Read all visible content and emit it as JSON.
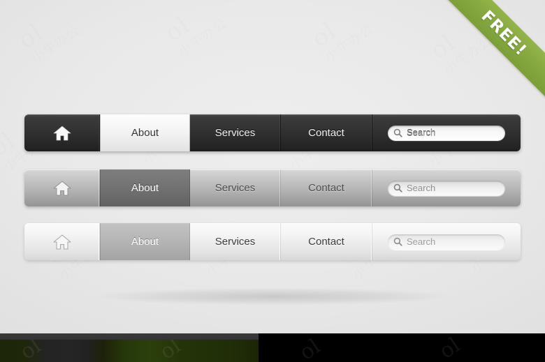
{
  "ribbon": {
    "label": "FREE!",
    "color": "#86a940",
    "text_color": "#ffffff"
  },
  "background": {
    "color": "#e9e9e9",
    "watermark_text": "ol",
    "watermark_subtext": "小牛办公"
  },
  "navbars": [
    {
      "id": "dark",
      "style_name": "dark-navbar",
      "background_color": "#2b2b2b",
      "text_color": "#f2f2f2",
      "active_item": "About",
      "active_background": "#f3f3f3",
      "active_text_color": "#333333",
      "items": [
        {
          "name": "home",
          "label": "",
          "icon": "home-icon"
        },
        {
          "name": "about",
          "label": "About",
          "icon": ""
        },
        {
          "name": "services",
          "label": "Services",
          "icon": ""
        },
        {
          "name": "contact",
          "label": "Contact",
          "icon": ""
        }
      ],
      "search": {
        "placeholder": "Search",
        "value": "",
        "icon": "search-icon",
        "field_background": "#ffffff"
      }
    },
    {
      "id": "gray",
      "style_name": "gray-navbar",
      "background_color": "#b4b4b4",
      "text_color": "#4b4b4b",
      "active_item": "About",
      "active_background": "#737373",
      "active_text_color": "#ffffff",
      "items": [
        {
          "name": "home",
          "label": "",
          "icon": "home-icon"
        },
        {
          "name": "about",
          "label": "About",
          "icon": ""
        },
        {
          "name": "services",
          "label": "Services",
          "icon": ""
        },
        {
          "name": "contact",
          "label": "Contact",
          "icon": ""
        }
      ],
      "search": {
        "placeholder": "Search",
        "value": "",
        "icon": "search-icon",
        "field_background": "#f2f2f2"
      }
    },
    {
      "id": "light",
      "style_name": "light-navbar",
      "background_color": "#eeeeee",
      "text_color": "#3c3c3c",
      "active_item": "About",
      "active_background": "#b6b6b6",
      "active_text_color": "#ffffff",
      "items": [
        {
          "name": "home",
          "label": "",
          "icon": "home-icon"
        },
        {
          "name": "about",
          "label": "About",
          "icon": ""
        },
        {
          "name": "services",
          "label": "Services",
          "icon": ""
        },
        {
          "name": "contact",
          "label": "Contact",
          "icon": ""
        }
      ],
      "search": {
        "placeholder": "Search",
        "value": "",
        "icon": "search-icon",
        "field_background": "#f5f5f5"
      }
    }
  ],
  "bottom_strip": {
    "left_panel_color": "#243409",
    "right_panel_color": "#000000",
    "top_bar_color": "#363636"
  }
}
